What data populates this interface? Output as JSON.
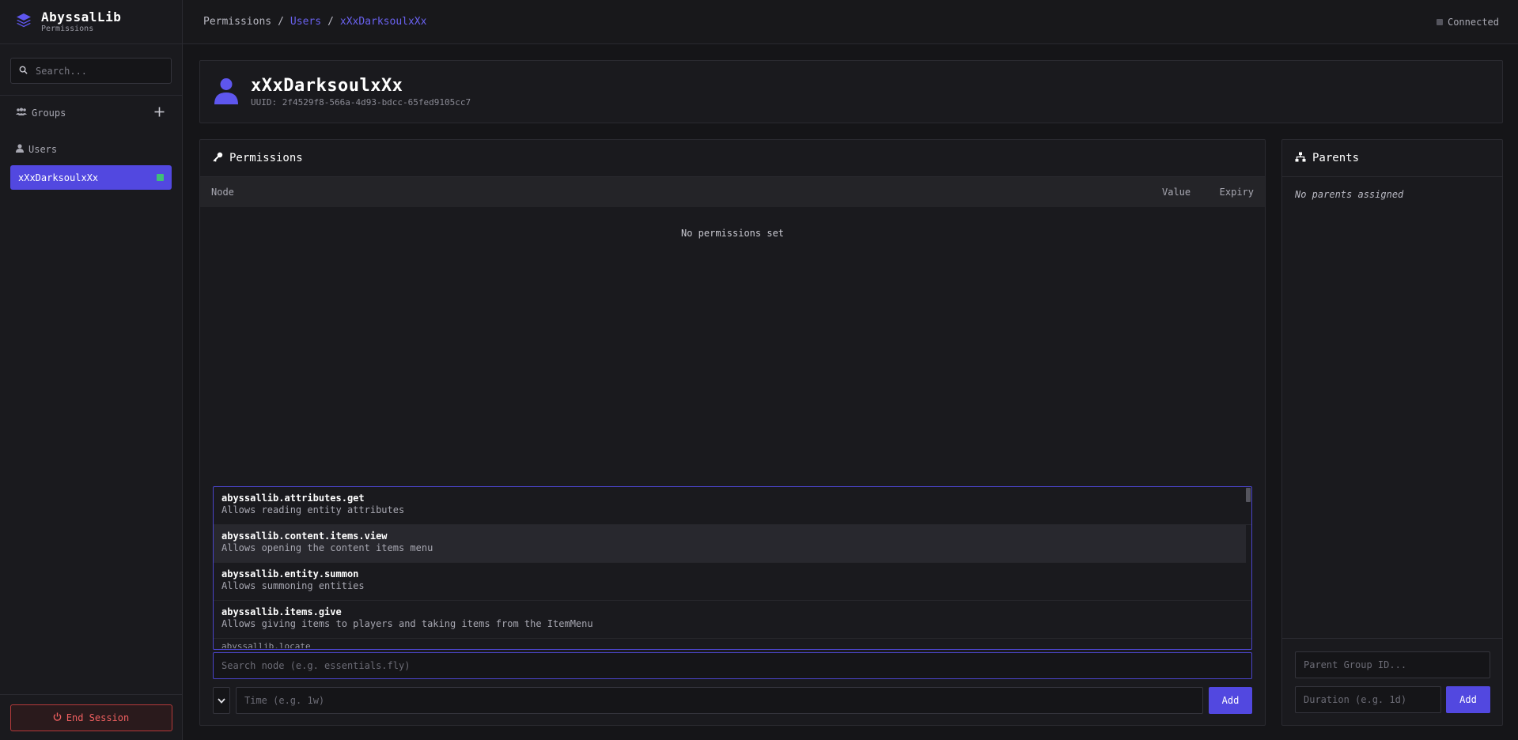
{
  "brand": {
    "title": "AbyssalLib",
    "subtitle": "Permissions"
  },
  "sidebar": {
    "search_placeholder": "Search...",
    "groups_label": "Groups",
    "users_label": "Users",
    "users": [
      {
        "name": "xXxDarksoulxXx",
        "online": true
      }
    ],
    "end_session_label": "End Session"
  },
  "topbar": {
    "crumbs": [
      "Permissions",
      "/",
      "Users",
      "/",
      "xXxDarksoulxXx"
    ],
    "status": "Connected"
  },
  "user": {
    "name": "xXxDarksoulxXx",
    "uuid": "UUID: 2f4529f8-566a-4d93-bdcc-65fed9105cc7"
  },
  "permissions": {
    "title": "Permissions",
    "columns": [
      "Node",
      "Value",
      "Expiry"
    ],
    "empty_message": "No permissions set",
    "suggestions": [
      {
        "node": "abyssallib.attributes.get",
        "desc": "Allows reading entity attributes"
      },
      {
        "node": "abyssallib.content.items.view",
        "desc": "Allows opening the content items menu"
      },
      {
        "node": "abyssallib.entity.summon",
        "desc": "Allows summoning entities"
      },
      {
        "node": "abyssallib.items.give",
        "desc": "Allows giving items to players and taking items from the ItemMenu"
      }
    ],
    "suggestion_partial": "abyssallib.locate",
    "node_placeholder": "Search node (e.g. essentials.fly)",
    "time_placeholder": "Time (e.g. 1w)",
    "add_label": "Add"
  },
  "parents": {
    "title": "Parents",
    "empty_message": "No parents assigned",
    "group_placeholder": "Parent Group ID...",
    "duration_placeholder": "Duration (e.g. 1d)",
    "add_label": "Add"
  },
  "colors": {
    "accent": "#5248e0",
    "online": "#3fbf78",
    "danger": "#f06060"
  }
}
